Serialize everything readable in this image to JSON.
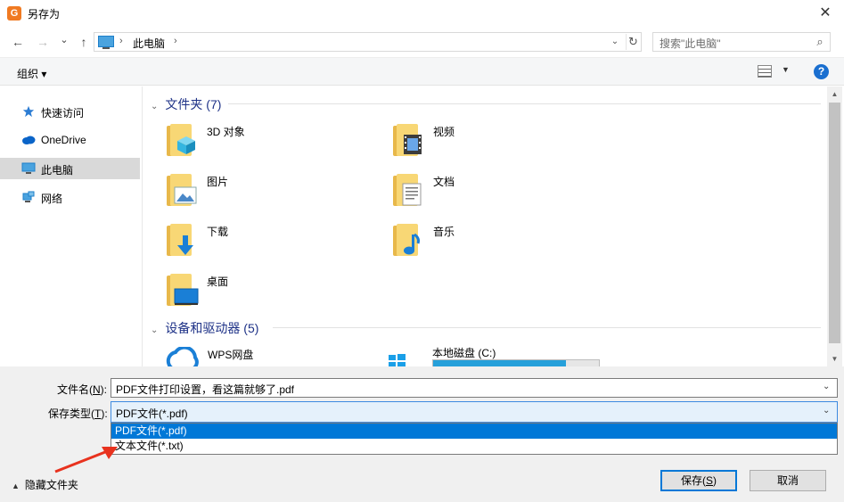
{
  "window": {
    "title": "另存为",
    "app_icon_letter": "G",
    "close": "✕"
  },
  "nav": {
    "back": "←",
    "forward": "→",
    "recent": "⌄",
    "up": "↑",
    "address_separator": "›",
    "address_location": "此电脑",
    "address_trailing_separator": "›",
    "refresh": "↻",
    "dropdown": "⌄",
    "search_placeholder": "搜索\"此电脑\"",
    "search_icon": "⌕"
  },
  "commandbar": {
    "organize_label": "组织 ▾",
    "view_dropdown": "▼",
    "help_label": "?"
  },
  "sidebar": {
    "items": [
      {
        "label": "快速访问",
        "icon": "star-icon",
        "selected": false
      },
      {
        "label": "OneDrive",
        "icon": "cloud-icon",
        "selected": false
      },
      {
        "label": "此电脑",
        "icon": "computer-icon",
        "selected": true
      },
      {
        "label": "网络",
        "icon": "network-icon",
        "selected": false
      }
    ]
  },
  "content": {
    "folders_header": "文件夹 (7)",
    "folders": [
      {
        "label": "3D 对象",
        "icon": "3d-objects-folder-icon"
      },
      {
        "label": "视频",
        "icon": "videos-folder-icon"
      },
      {
        "label": "图片",
        "icon": "pictures-folder-icon"
      },
      {
        "label": "文档",
        "icon": "documents-folder-icon"
      },
      {
        "label": "下载",
        "icon": "downloads-folder-icon"
      },
      {
        "label": "音乐",
        "icon": "music-folder-icon"
      },
      {
        "label": "桌面",
        "icon": "desktop-folder-icon"
      }
    ],
    "devices_header": "设备和驱动器 (5)",
    "devices": [
      {
        "label": "WPS网盘",
        "icon": "wps-cloud-icon"
      },
      {
        "label": "本地磁盘 (C:)",
        "icon": "windows-drive-icon",
        "used_fraction": 0.8
      }
    ],
    "header_chevron": "⌄"
  },
  "scrollbar": {
    "up": "▲",
    "down": "▼"
  },
  "footer": {
    "filename_label": "文件名(",
    "filename_key": "N",
    "filename_label_end": "):",
    "filename_value": "PDF文件打印设置，看这篇就够了.pdf",
    "filetype_label": "保存类型(",
    "filetype_key": "T",
    "filetype_label_end": "):",
    "filetype_value": "PDF文件(*.pdf)",
    "dropdown_chevron": "⌄",
    "filetype_options": [
      {
        "label": "PDF文件(*.pdf)",
        "selected": true
      },
      {
        "label": "文本文件(*.txt)",
        "selected": false
      }
    ],
    "hide_folders_chevron": "▲",
    "hide_folders_label": "隐藏文件夹",
    "save_label": "保存(",
    "save_key": "S",
    "save_label_end": ")",
    "cancel_label": "取消"
  },
  "colors": {
    "accent": "#0078d7",
    "folder": "#f8d775",
    "group_header": "#1e3287",
    "annotation_arrow": "#e8321e"
  }
}
